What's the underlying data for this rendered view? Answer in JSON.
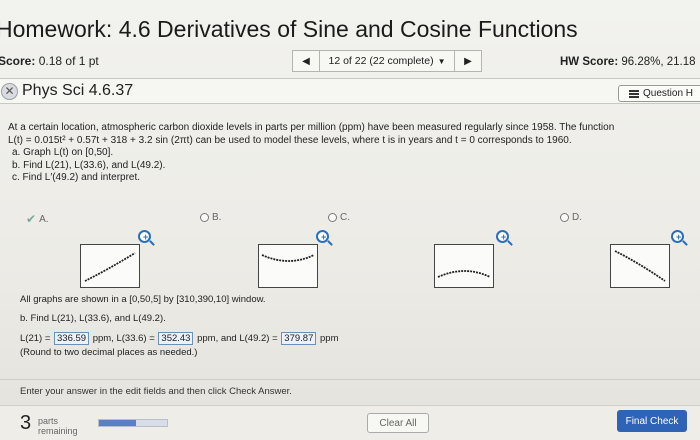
{
  "header": {
    "title": "Homework: 4.6 Derivatives of Sine and Cosine Functions"
  },
  "score_bar": {
    "score_label": "Score:",
    "score_value": "0.18 of 1 pt",
    "nav_position": "12 of 22 (22 complete)",
    "prev_icon": "triangle-left-icon",
    "next_icon": "triangle-right-icon",
    "dropdown_icon": "triangle-down-icon",
    "hw_score_label": "HW Score:",
    "hw_score_value": "96.28%, 21.18"
  },
  "question": {
    "title": "Phys Sci 4.6.37",
    "status_icon": "partial-credit-icon",
    "help_label": "Question H"
  },
  "problem": {
    "intro_1": "At a certain location, atmospheric carbon dioxide levels in parts per million (ppm) have been measured regularly since 1958. The function",
    "intro_2": "L(t) = 0.015t² + 0.57t + 318 + 3.2 sin (2πt) can be used to model these levels, where t is in years and t = 0 corresponds to 1960.",
    "part_a": "a. Graph L(t) on [0,50].",
    "part_b": "b. Find L(21), L(33.6), and L(49.2).",
    "part_c": "c. Find L′(49.2) and interpret."
  },
  "choices": [
    {
      "label": "A.",
      "selected": true
    },
    {
      "label": "B.",
      "selected": false
    },
    {
      "label": "C.",
      "selected": false
    },
    {
      "label": "D.",
      "selected": false
    }
  ],
  "lower": {
    "window_note": "All graphs are shown in a [0,50,5] by [310,390,10] window.",
    "part_b_prompt": "b. Find L(21), L(33.6), and L(49.2).",
    "ans_prefix": "L(21) =",
    "ans_1": "336.59",
    "ans_mid_1": "ppm, L(33.6) =",
    "ans_2": "352.43",
    "ans_mid_2": "ppm, and L(49.2) =",
    "ans_3": "379.87",
    "ans_suffix": "ppm",
    "rounding": "(Round to two decimal places as needed.)"
  },
  "instructions": "Enter your answer in the edit fields and then click Check Answer.",
  "footer": {
    "parts_count": "3",
    "parts_label_1": "parts",
    "parts_label_2": "remaining",
    "progress_fraction": 0.55,
    "clear_label": "Clear All",
    "final_label": "Final Check"
  }
}
